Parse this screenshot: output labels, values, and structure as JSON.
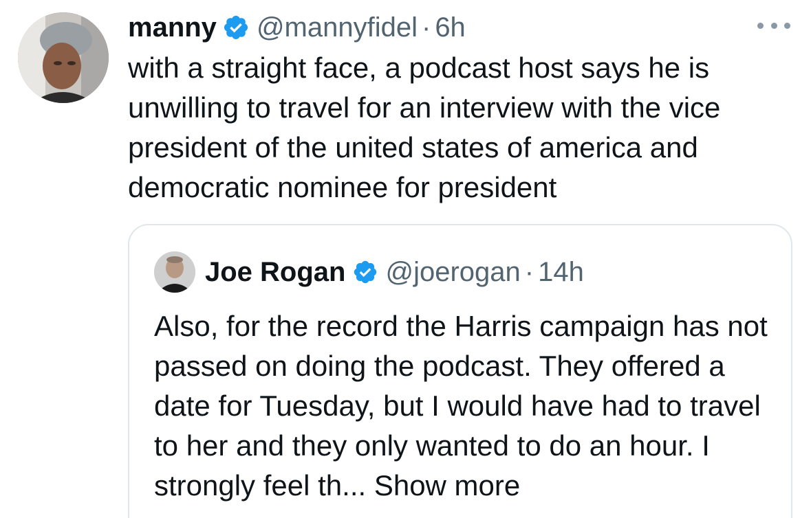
{
  "tweet": {
    "author_name": "manny",
    "author_handle": "@mannyfidel",
    "separator": "·",
    "time": "6h",
    "text": "with a straight face, a podcast host says he is unwilling to travel for an interview with the vice president of the united states of america and democratic nominee for president",
    "more_icon": "more-horizontal-icon"
  },
  "quoted_tweet": {
    "author_name": "Joe Rogan",
    "author_handle": "@joerogan",
    "separator": "·",
    "time": "14h",
    "text": "Also, for the record the Harris campaign has not passed on doing the podcast.  They offered a date for Tuesday, but I would have had to travel to her and they only wanted to do an hour.  I strongly feel th...",
    "show_more_label": "Show more"
  },
  "colors": {
    "verified_blue": "#1d9bf0",
    "text_primary": "#0f1419",
    "text_secondary": "#536471",
    "border": "#e1e6ea"
  }
}
